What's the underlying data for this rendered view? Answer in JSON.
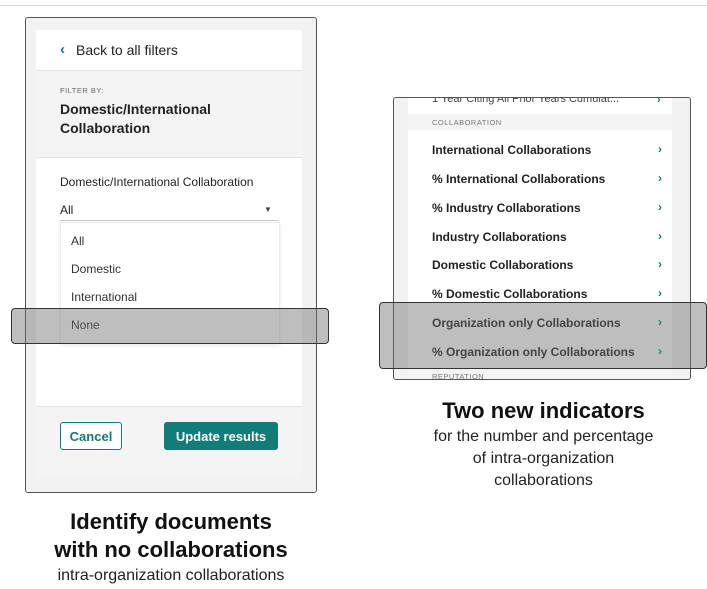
{
  "left_panel": {
    "back_label": "Back to all filters",
    "filter_by": "FILTER BY:",
    "filter_title": "Domestic/International Collaboration",
    "field_label": "Domestic/International Collaboration",
    "selected_value": "All",
    "options": [
      "All",
      "Domestic",
      "International",
      "None"
    ],
    "cancel_label": "Cancel",
    "update_label": "Update results",
    "caption_line1": "Identify documents",
    "caption_line2": "with no collaborations",
    "caption_sub": "intra-organization collaborations"
  },
  "right_panel": {
    "cut_row": "1 Year Citing All Prior Years Cumulat...",
    "section_collab": "COLLABORATION",
    "rows": [
      "International Collaborations",
      "% International Collaborations",
      "% Industry Collaborations",
      "Industry Collaborations",
      "Domestic Collaborations",
      "% Domestic Collaborations",
      "Organization only Collaborations",
      "% Organization only Collaborations"
    ],
    "section_reputation": "REPUTATION",
    "caption_title": "Two new indicators",
    "caption_sub1": "for the number and percentage",
    "caption_sub2": "of intra-organization",
    "caption_sub3": "collaborations"
  },
  "colors": {
    "accent": "#127c78",
    "highlight": "#6e6e6e"
  },
  "icons": {
    "back": "chevron-left-icon",
    "row": "chevron-right-icon",
    "select": "caret-down-icon"
  }
}
